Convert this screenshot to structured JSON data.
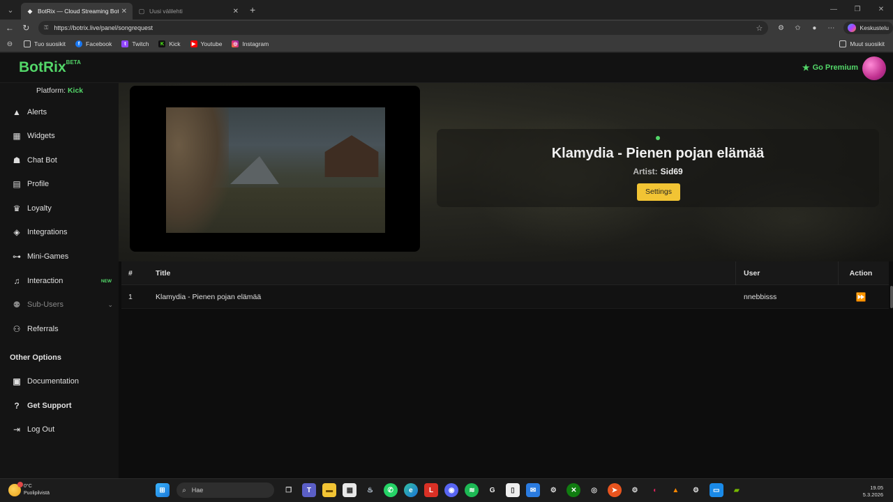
{
  "browser": {
    "tabs": [
      {
        "label": "BotRix — Cloud Streaming Bot for",
        "active": true
      },
      {
        "label": "Uusi välilehti",
        "active": false
      }
    ],
    "url": "https://botrix.live/panel/songrequest",
    "profile_label": "Keskustelu",
    "bookmarks": [
      {
        "label": "Tuo suosikit",
        "icon": "import-icon"
      },
      {
        "label": "Facebook",
        "icon": "facebook-icon"
      },
      {
        "label": "Twitch",
        "icon": "twitch-icon"
      },
      {
        "label": "Kick",
        "icon": "kick-icon"
      },
      {
        "label": "Youtube",
        "icon": "youtube-icon"
      },
      {
        "label": "Instagram",
        "icon": "instagram-icon"
      }
    ],
    "other_bookmarks": "Muut suosikit"
  },
  "app": {
    "logo": "BotRix",
    "logo_badge": "BETA",
    "premium_label": "Go Premium",
    "platform_label": "Platform:",
    "platform_value": "Kick",
    "nav": [
      {
        "label": "Alerts",
        "icon": "warning-icon"
      },
      {
        "label": "Widgets",
        "icon": "grid-icon"
      },
      {
        "label": "Chat Bot",
        "icon": "robot-icon"
      },
      {
        "label": "Profile",
        "icon": "id-card-icon"
      },
      {
        "label": "Loyalty",
        "icon": "trophy-icon"
      },
      {
        "label": "Integrations",
        "icon": "cube-icon"
      },
      {
        "label": "Mini-Games",
        "icon": "gamepad-icon"
      },
      {
        "label": "Interaction",
        "icon": "music-icon",
        "badge": "NEW"
      },
      {
        "label": "Sub-Users",
        "icon": "users-cog-icon"
      },
      {
        "label": "Referrals",
        "icon": "users-icon"
      }
    ],
    "other_options_heading": "Other Options",
    "other_options": [
      {
        "label": "Documentation",
        "icon": "book-icon"
      },
      {
        "label": "Get Support",
        "icon": "question-icon"
      },
      {
        "label": "Log Out",
        "icon": "logout-icon"
      }
    ]
  },
  "now_playing": {
    "title": "Klamydia - Pienen pojan elämää",
    "artist_label": "Artist:",
    "artist": "Sid69",
    "settings_label": "Settings"
  },
  "queue": {
    "headers": {
      "num": "#",
      "title": "Title",
      "user": "User",
      "action": "Action"
    },
    "rows": [
      {
        "num": "1",
        "title": "Klamydia - Pienen pojan elämää",
        "user": "nnebbisss"
      }
    ]
  },
  "taskbar": {
    "weather_temp": "0°C",
    "weather_desc": "Puolipilvistä",
    "search_placeholder": "Hae",
    "time": "19.05",
    "date": "5.3.2026"
  }
}
